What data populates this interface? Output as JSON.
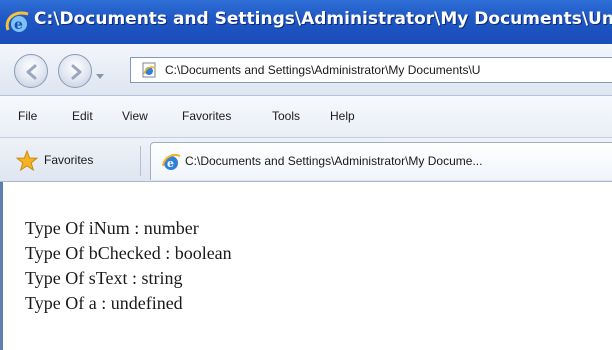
{
  "window": {
    "title": "C:\\Documents and Settings\\Administrator\\My Documents\\Un"
  },
  "navigation": {
    "address": "C:\\Documents and Settings\\Administrator\\My Documents\\U"
  },
  "menu": {
    "items": [
      "File",
      "Edit",
      "View",
      "Favorites",
      "Tools",
      "Help"
    ]
  },
  "favorites_bar": {
    "favorites_label": "Favorites",
    "tab_label": "C:\\Documents and Settings\\Administrator\\My Docume..."
  },
  "content": {
    "lines": [
      "Type Of iNum : number",
      "Type Of bChecked : boolean",
      "Type Of sText : string",
      "Type Of a : undefined"
    ]
  },
  "colors": {
    "title_bar": "#1e56c4",
    "toolbar": "#dde5f1",
    "favorites_star": "#f3b324",
    "ie_logo": "#2f7fd8"
  }
}
